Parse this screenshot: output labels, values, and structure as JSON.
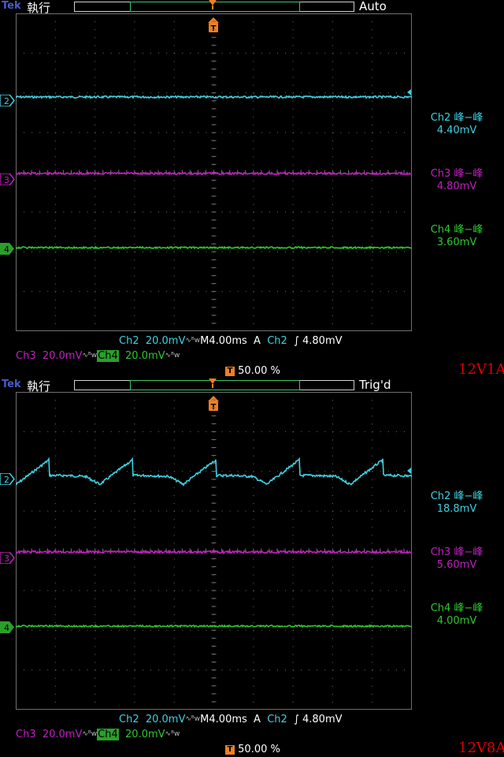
{
  "screens": [
    {
      "brand": "Tek",
      "mode": "執行",
      "state": "Auto",
      "tag": "12V1A",
      "measurements": [
        {
          "channel": "Ch2",
          "label": "Ch2 峰−峰",
          "value": "4.40mV",
          "color": "#3fd0e0"
        },
        {
          "channel": "Ch3",
          "label": "Ch3 峰−峰",
          "value": "4.80mV",
          "color": "#c020c0"
        },
        {
          "channel": "Ch4",
          "label": "Ch4 峰−峰",
          "value": "3.60mV",
          "color": "#2ec82e"
        }
      ],
      "status": {
        "ch2_label": "Ch2",
        "ch2_scale": "20.0mV",
        "ch3_label": "Ch3",
        "ch3_scale": "20.0mV",
        "ch4_label": "Ch4",
        "ch4_scale": "20.0mV",
        "timebase": "M4.00ms",
        "trigger_mode": "A",
        "trigger_source": "Ch2",
        "trigger_slope": "∫",
        "trigger_level": "4.80mV",
        "trigger_position": "50.00 %"
      },
      "ground_markers": [
        "2",
        "3",
        "4"
      ]
    },
    {
      "brand": "Tek",
      "mode": "執行",
      "state": "Trig'd",
      "tag": "12V8A",
      "measurements": [
        {
          "channel": "Ch2",
          "label": "Ch2 峰−峰",
          "value": "18.8mV",
          "color": "#3fd0e0"
        },
        {
          "channel": "Ch3",
          "label": "Ch3 峰−峰",
          "value": "5.60mV",
          "color": "#c020c0"
        },
        {
          "channel": "Ch4",
          "label": "Ch4 峰−峰",
          "value": "4.00mV",
          "color": "#2ec82e"
        }
      ],
      "status": {
        "ch2_label": "Ch2",
        "ch2_scale": "20.0mV",
        "ch3_label": "Ch3",
        "ch3_scale": "20.0mV",
        "ch4_label": "Ch4",
        "ch4_scale": "20.0mV",
        "timebase": "M4.00ms",
        "trigger_mode": "A",
        "trigger_source": "Ch2",
        "trigger_slope": "∫",
        "trigger_level": "4.80mV",
        "trigger_position": "50.00 %"
      },
      "ground_markers": [
        "2",
        "3",
        "4"
      ]
    }
  ],
  "colors": {
    "ch2": "#3fd0e0",
    "ch3": "#c020c0",
    "ch4": "#2ec82e",
    "trigger": "#f08020",
    "grid": "#707070"
  },
  "icons": {
    "trigger_marker": "trigger-t-icon",
    "ground_marker": "channel-ground-arrow-icon"
  }
}
